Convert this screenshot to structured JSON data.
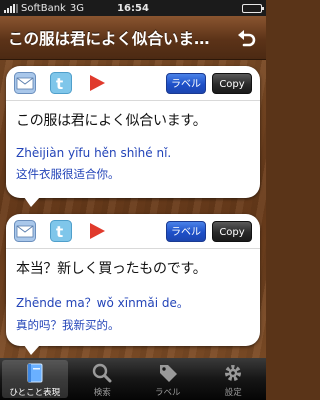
{
  "status": {
    "carrier": "SoftBank",
    "network": "3G",
    "time": "16:54"
  },
  "nav": {
    "title": "この服は君によく似合いま…"
  },
  "cards": [
    {
      "label_button": "ラベル",
      "copy_button": "Copy",
      "japanese": "この服は君によく似合います。",
      "pinyin": "Zhèijiàn yīfu hěn shìhé nǐ.",
      "chinese": "这件衣服很适合你。"
    },
    {
      "label_button": "ラベル",
      "copy_button": "Copy",
      "japanese": "本当？新しく買ったものです。",
      "pinyin": "Zhēnde ma？wǒ xīnmǎi de。",
      "chinese": "真的吗？我新买的。"
    }
  ],
  "tabs": [
    {
      "label": "ひとこと表現",
      "icon": "book-icon",
      "active": true
    },
    {
      "label": "検索",
      "icon": "search-icon",
      "active": false
    },
    {
      "label": "ラベル",
      "icon": "tag-icon",
      "active": false
    },
    {
      "label": "設定",
      "icon": "gear-icon",
      "active": false
    }
  ],
  "colors": {
    "accent_blue": "#1e50c8",
    "text_blue": "#2344b8",
    "nav_brown": "#5c3318",
    "play_red": "#e03a2c"
  }
}
